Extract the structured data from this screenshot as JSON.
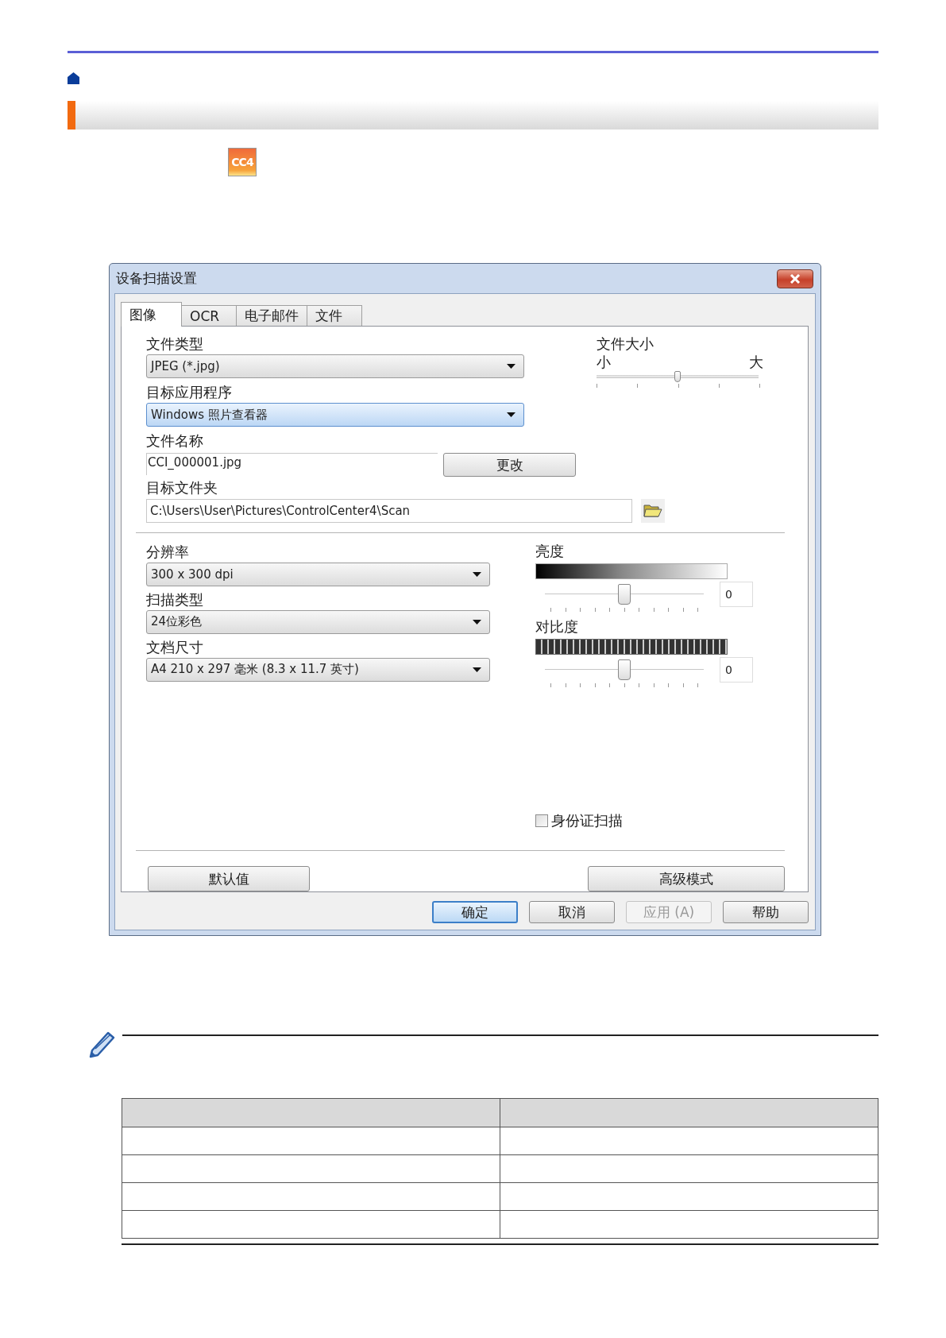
{
  "app_icon": {
    "label": "CC4"
  },
  "dialog": {
    "title": "设备扫描设置",
    "tabs": [
      {
        "label": "图像",
        "selected": true
      },
      {
        "label": "OCR",
        "selected": false
      },
      {
        "label": "电子邮件",
        "selected": false
      },
      {
        "label": "文件",
        "selected": false
      }
    ],
    "file_type": {
      "label": "文件类型",
      "value": "JPEG (*.jpg)",
      "highlighted": false
    },
    "target_app": {
      "label": "目标应用程序",
      "value": "Windows 照片查看器",
      "highlighted": true
    },
    "file_size": {
      "label": "文件大小",
      "min_label": "小",
      "max_label": "大",
      "level": 0.5
    },
    "file_name": {
      "label": "文件名称",
      "value": "CCI_000001.jpg",
      "button": "更改"
    },
    "target_folder": {
      "label": "目标文件夹",
      "value": "C:\\Users\\User\\Pictures\\ControlCenter4\\Scan"
    },
    "dropdowns": [
      {
        "label": "分辨率",
        "value": "300 x 300 dpi"
      },
      {
        "label": "扫描类型",
        "value": "24位彩色"
      },
      {
        "label": "文档尺寸",
        "value": "A4 210 x 297 毫米 (8.3 x 11.7 英寸)"
      }
    ],
    "adjustments": [
      {
        "kind": "brightness",
        "label": "亮度",
        "level": 0.5,
        "value": "0"
      },
      {
        "kind": "contrast",
        "label": "对比度",
        "level": 0.5,
        "value": "0"
      }
    ],
    "id_card_scan": {
      "label": "身份证扫描",
      "checked": false
    },
    "default_button": "默认值",
    "advanced_button": "高级模式",
    "buttons": [
      {
        "label": "确定",
        "default": true,
        "disabled": false
      },
      {
        "label": "取消",
        "default": false,
        "disabled": false
      },
      {
        "label": "应用 (A)",
        "default": false,
        "disabled": true
      },
      {
        "label": "帮助",
        "default": false,
        "disabled": false
      }
    ]
  }
}
